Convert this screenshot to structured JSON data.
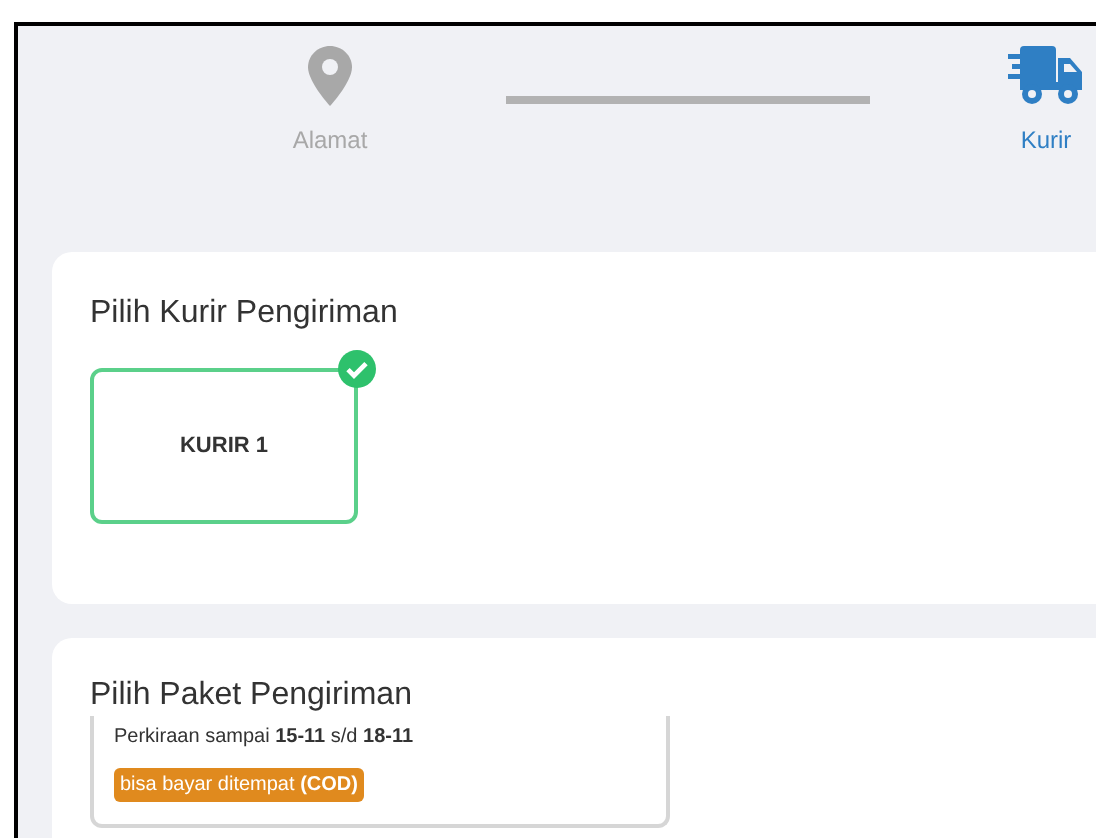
{
  "steps": [
    {
      "kind": "location",
      "label": "Alamat",
      "selected": false
    },
    {
      "kind": "courier",
      "label": "Kurir",
      "selected": true
    }
  ],
  "courier_section": {
    "title": "Pilih Kurir Pengiriman",
    "options": [
      {
        "label": "KURIR 1",
        "selected": true
      }
    ]
  },
  "package_section": {
    "title": "Pilih Paket Pengiriman",
    "packages": [
      {
        "estimate": "Perkiraan sampai **15-11** s/d **18-11**",
        "badge": "bisa bayar ditempat **(COD)**"
      }
    ]
  }
}
